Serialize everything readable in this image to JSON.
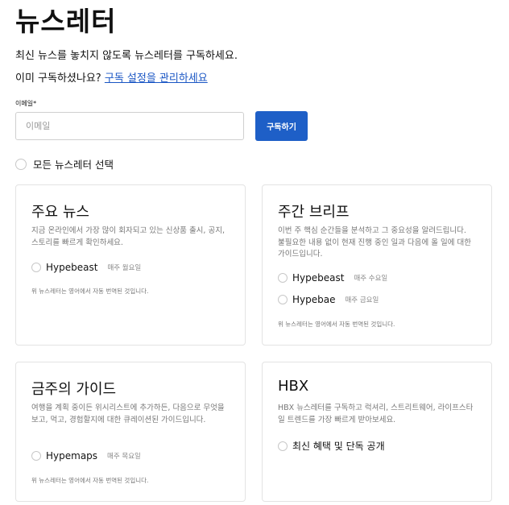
{
  "page_title": "뉴스레터",
  "intro_text": "최신 뉴스를 놓치지 않도록 뉴스레터를 구독하세요.",
  "manage": {
    "question": "이미 구독하셨나요? ",
    "link": "구독 설정을 관리하세요"
  },
  "email": {
    "label": "이메일*",
    "placeholder": "이메일",
    "value": ""
  },
  "subscribe_label": "구독하기",
  "select_all_label": "모든 뉴스레터 선택",
  "cards": [
    {
      "title": "주요 뉴스",
      "description": "지금 온라인에서 가장 많이 회자되고 있는 신상품 출시, 공지, 스토리를 빠르게 확인하세요.",
      "options": [
        {
          "name": "Hypebeast",
          "frequency": "매주 월요일"
        }
      ],
      "note": "위 뉴스레터는 영어에서 자동 번역된 것입니다."
    },
    {
      "title": "주간 브리프",
      "description": "이번 주 핵심 순간들을 분석하고 그 중요성을 알려드립니다. 불필요한 내용 없이 현재 진행 중인 일과 다음에 올 일에 대한 가이드입니다.",
      "options": [
        {
          "name": "Hypebeast",
          "frequency": "매주 수요일"
        },
        {
          "name": "Hypebae",
          "frequency": "매주 금요일"
        }
      ],
      "note": "위 뉴스레터는 영어에서 자동 번역된 것입니다."
    },
    {
      "title": "금주의 가이드",
      "description": "여행을 계획 중이든 위시리스트에 추가하든, 다음으로 무엇을 보고, 먹고, 경험할지에 대한 큐레이션된 가이드입니다.",
      "options": [
        {
          "name": "Hypemaps",
          "frequency": "매주 목요일"
        }
      ],
      "note": "위 뉴스레터는 영어에서 자동 번역된 것입니다."
    },
    {
      "title": "HBX",
      "description": "HBX 뉴스레터를 구독하고 럭셔리, 스트리트웨어, 라이프스타일 트렌드를 가장 빠르게 받아보세요.",
      "options": [
        {
          "name": "최신 혜택 및 단독 공개",
          "frequency": ""
        }
      ],
      "note": ""
    }
  ],
  "colors": {
    "primary_button": "#1e5fc7",
    "link": "#1a56c4"
  }
}
